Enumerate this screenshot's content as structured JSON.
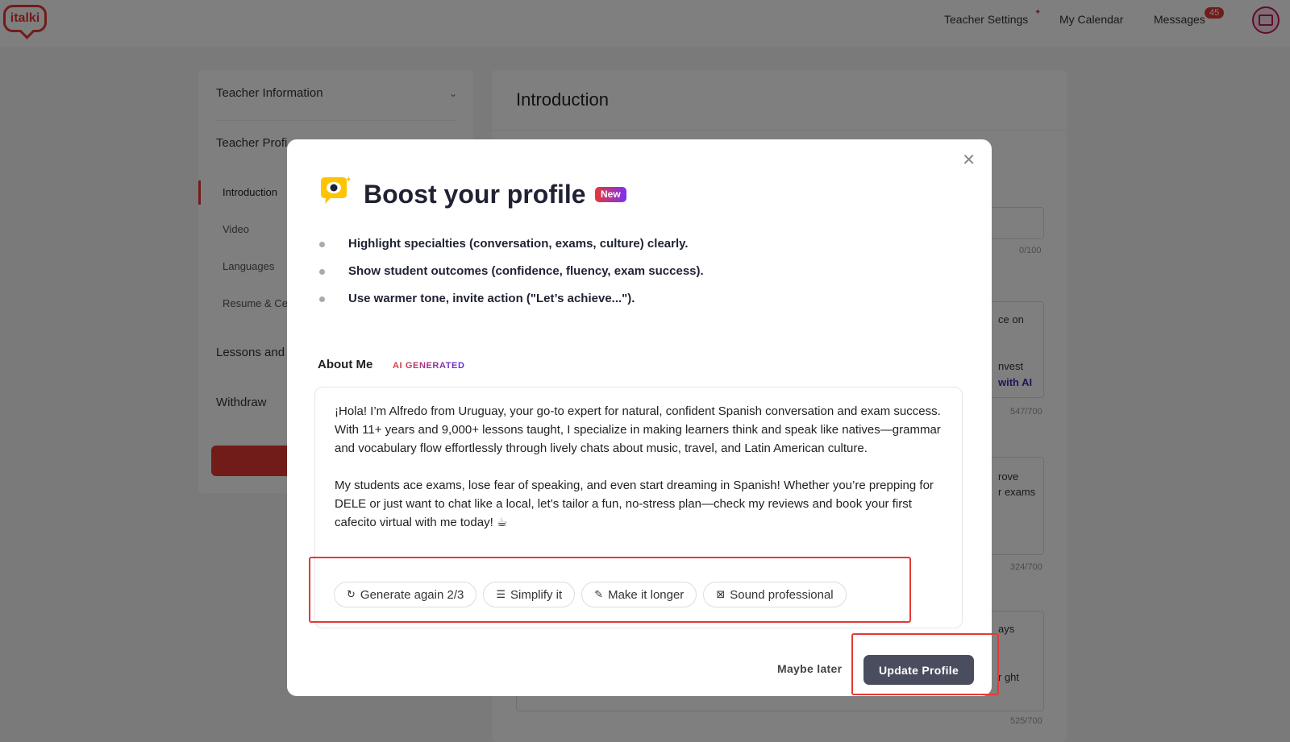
{
  "nav": {
    "logo": "italki",
    "teacher_settings": "Teacher Settings",
    "my_calendar": "My Calendar",
    "messages": "Messages",
    "messages_count": "45"
  },
  "sidebar": {
    "teacher_information": "Teacher Information",
    "teacher_profile": "Teacher Profi",
    "items": [
      "Introduction",
      "Video",
      "Languages",
      "Resume & Ce"
    ],
    "lessons": "Lessons and",
    "withdraw": "Withdraw"
  },
  "main": {
    "title": "Introduction",
    "counts": [
      "0/100",
      "547/700",
      "324/700",
      "525/700"
    ],
    "snippets": [
      "ce on",
      "nvest",
      "rove",
      "r exams",
      "ays",
      "r ght"
    ],
    "ai_link": "with AI"
  },
  "modal": {
    "title": "Boost your profile",
    "new_badge": "New",
    "tips": [
      "Highlight specialties (conversation, exams, culture) clearly.",
      "Show student outcomes (confidence, fluency, exam success).",
      "Use warmer tone, invite action (\"Let’s achieve...\")."
    ],
    "about_label": "About Me",
    "ai_generated": "AI GENERATED",
    "about_text_1": "¡Hola! I’m Alfredo from Uruguay, your go-to expert for natural, confident Spanish conversation and exam success. With 11+ years and 9,000+ lessons taught, I specialize in making learners think and speak like natives—grammar and vocabulary flow effortlessly through lively chats about music, travel, and Latin American culture.",
    "about_text_2": "My students ace exams, lose fear of speaking, and even start dreaming in Spanish! Whether you’re prepping for DELE or just want to chat like a local, let’s tailor a fun, no-stress plan—check my reviews and book your first cafecito virtual with me today! ☕",
    "actions": {
      "generate_again": "Generate again 2/3",
      "simplify": "Simplify it",
      "make_longer": "Make it longer",
      "sound_professional": "Sound professional"
    },
    "maybe_later": "Maybe later",
    "update_profile": "Update Profile"
  },
  "colors": {
    "brand_red": "#e53935",
    "button_dark": "#4a4d5e"
  }
}
